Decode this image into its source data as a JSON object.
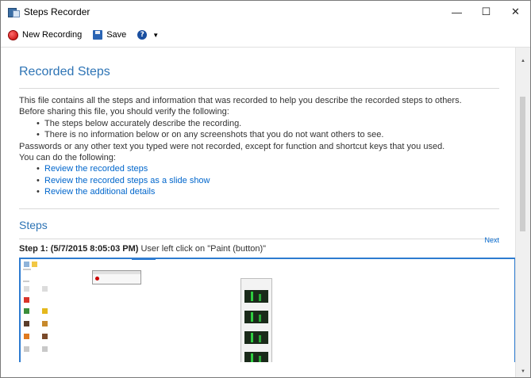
{
  "window": {
    "title": "Steps Recorder",
    "minimize_glyph": "—",
    "maximize_glyph": "☐",
    "close_glyph": "✕"
  },
  "toolbar": {
    "new_recording_label": "New Recording",
    "save_label": "Save",
    "help_glyph": "?",
    "dropdown_glyph": "▼"
  },
  "main": {
    "recorded_steps_heading": "Recorded Steps",
    "intro": "This file contains all the steps and information that was recorded to help you describe the recorded steps to others.",
    "verify_intro": "Before sharing this file, you should verify the following:",
    "verify_items": [
      "The steps below accurately describe the recording.",
      "There is no information below or on any screenshots that you do not want others to see."
    ],
    "passwords_note": "Passwords or any other text you typed were not recorded, except for function and shortcut keys that you used.",
    "can_do_intro": "You can do the following:",
    "links": [
      "Review the recorded steps",
      "Review the recorded steps as a slide show",
      "Review the additional details"
    ],
    "steps_heading": "Steps",
    "next_link": "Next",
    "step1": {
      "label": "Step 1: (5/7/2015 8:05:03 PM)",
      "description": "User left click on \"Paint (button)\""
    }
  },
  "colors": {
    "heading": "#2e74b5",
    "link": "#0066cc",
    "screenshot_border": "#2d7bd0"
  },
  "icons": [
    "app-icon",
    "record-icon",
    "save-icon",
    "help-icon",
    "dropdown-caret-icon"
  ]
}
